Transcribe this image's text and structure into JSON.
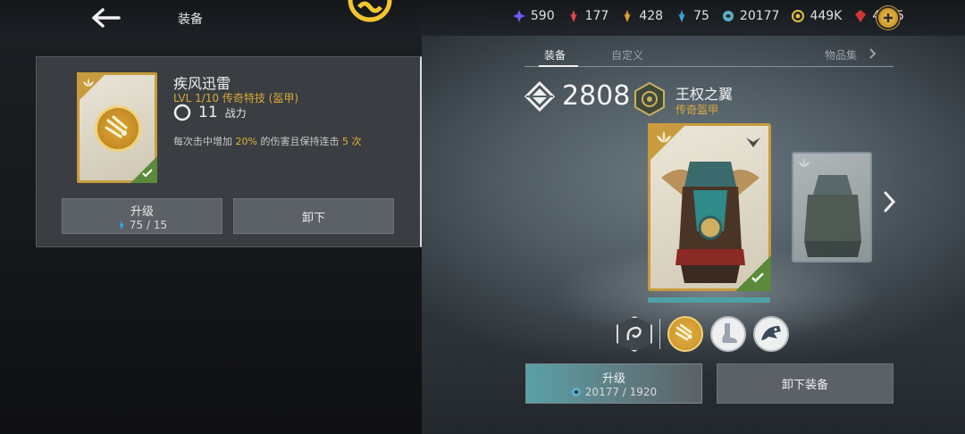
{
  "topbar": {
    "title": "装备",
    "currencies": [
      {
        "icon": "shard-purple-icon",
        "value": "590",
        "color": "#6a5cff"
      },
      {
        "icon": "crystal-red-icon",
        "value": "177",
        "color": "#e04848"
      },
      {
        "icon": "crystal-gold-icon",
        "value": "428",
        "color": "#e0a030"
      },
      {
        "icon": "crystal-blue-icon",
        "value": "75",
        "color": "#3aa0e0"
      },
      {
        "icon": "steel-swirl-icon",
        "value": "20177",
        "color": "#5bb0c8"
      },
      {
        "icon": "coin-icon",
        "value": "449K",
        "color": "#e0c040"
      },
      {
        "icon": "gem-red-icon",
        "value": "4325",
        "color": "#d03838"
      }
    ]
  },
  "perk": {
    "name": "疾风迅雷",
    "level": "LVL  1/10  传奇特技 (盔甲)",
    "power": "11",
    "power_label": "战力",
    "desc_parts": [
      "每次击中增加 ",
      "20%",
      " 的伤害且保持连击  ",
      "5 次"
    ],
    "upgrade_label": "升级",
    "upgrade_cost": "75 / 15",
    "unequip_label": "卸下"
  },
  "tabs": [
    {
      "label": "装备"
    },
    {
      "label": "自定义"
    },
    {
      "label": "物品集"
    }
  ],
  "item": {
    "gear_score": "2808",
    "name": "王权之翼",
    "type": "传奇盔甲"
  },
  "actions": {
    "upgrade_label": "升级",
    "upgrade_cost": "20177 / 1920",
    "unequip_label": "卸下装备"
  },
  "colors": {
    "accent_gold": "#c89b3c",
    "accent_teal": "#4fa0a6"
  }
}
